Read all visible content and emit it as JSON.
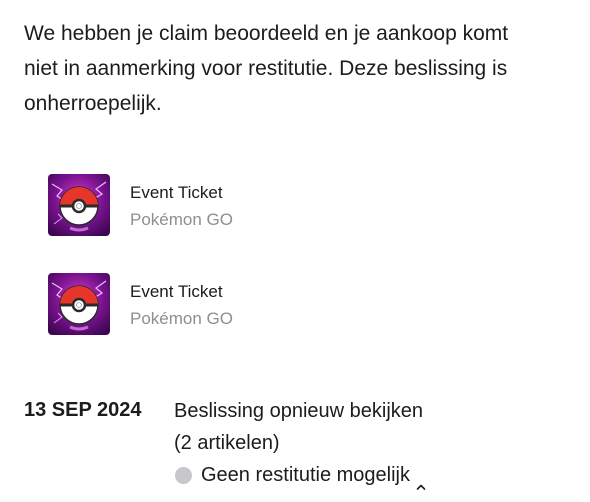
{
  "message": {
    "line1": "We hebben je claim beoordeeld en je aankoop komt",
    "line2": "niet in aanmerking voor restitutie. Deze beslissing is",
    "line3": "onherroepelijk."
  },
  "items": [
    {
      "title": "Event Ticket",
      "subtitle": "Pokémon GO",
      "icon": "pokeball-app-icon"
    },
    {
      "title": "Event Ticket",
      "subtitle": "Pokémon GO",
      "icon": "pokeball-app-icon"
    }
  ],
  "history": {
    "date": "13 SEP 2024",
    "action": "Beslissing opnieuw bekijken",
    "count": "(2 artikelen)",
    "status": "Geen restitutie mogelijk",
    "status_icon": "chevron-up-icon"
  },
  "colors": {
    "text": "#1c1c1e",
    "secondary_text": "#8e8e93",
    "status_dot": "#c7c7cc",
    "icon_background": "#5a0a6e",
    "pokeball_red": "#e8352c"
  }
}
